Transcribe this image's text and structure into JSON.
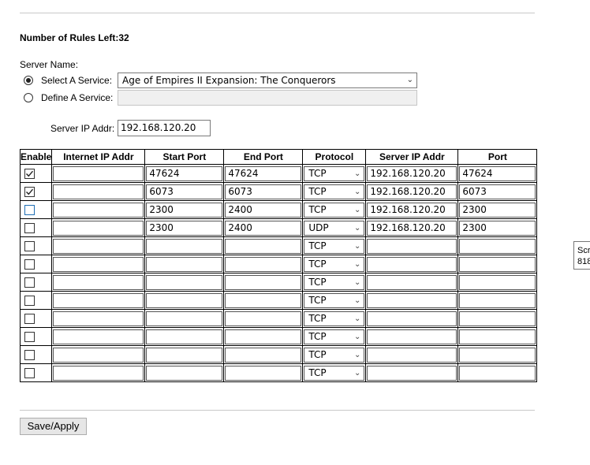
{
  "rules_left_label": "Number of Rules Left:32",
  "server_name_label": "Server Name:",
  "select_service": {
    "label": "Select A Service:",
    "selected": true,
    "value": "Age of Empires II Expansion: The Conquerors"
  },
  "define_service": {
    "label": "Define A Service:",
    "selected": false,
    "value": ""
  },
  "server_ip": {
    "label": "Server IP Addr:",
    "value": "192.168.120.20"
  },
  "table": {
    "headers": [
      "Enable",
      "Internet IP Addr",
      "Start Port",
      "End Port",
      "Protocol",
      "Server IP Addr",
      "Port"
    ],
    "rows": [
      {
        "enabled": true,
        "internet_ip": "",
        "start_port": "47624",
        "end_port": "47624",
        "protocol": "TCP",
        "server_ip": "192.168.120.20",
        "port": "47624"
      },
      {
        "enabled": true,
        "internet_ip": "",
        "start_port": "6073",
        "end_port": "6073",
        "protocol": "TCP",
        "server_ip": "192.168.120.20",
        "port": "6073"
      },
      {
        "enabled": false,
        "internet_ip": "",
        "start_port": "2300",
        "end_port": "2400",
        "protocol": "TCP",
        "server_ip": "192.168.120.20",
        "port": "2300"
      },
      {
        "enabled": false,
        "internet_ip": "",
        "start_port": "2300",
        "end_port": "2400",
        "protocol": "UDP",
        "server_ip": "192.168.120.20",
        "port": "2300"
      },
      {
        "enabled": false,
        "internet_ip": "",
        "start_port": "",
        "end_port": "",
        "protocol": "TCP",
        "server_ip": "",
        "port": ""
      },
      {
        "enabled": false,
        "internet_ip": "",
        "start_port": "",
        "end_port": "",
        "protocol": "TCP",
        "server_ip": "",
        "port": ""
      },
      {
        "enabled": false,
        "internet_ip": "",
        "start_port": "",
        "end_port": "",
        "protocol": "TCP",
        "server_ip": "",
        "port": ""
      },
      {
        "enabled": false,
        "internet_ip": "",
        "start_port": "",
        "end_port": "",
        "protocol": "TCP",
        "server_ip": "",
        "port": ""
      },
      {
        "enabled": false,
        "internet_ip": "",
        "start_port": "",
        "end_port": "",
        "protocol": "TCP",
        "server_ip": "",
        "port": ""
      },
      {
        "enabled": false,
        "internet_ip": "",
        "start_port": "",
        "end_port": "",
        "protocol": "TCP",
        "server_ip": "",
        "port": ""
      },
      {
        "enabled": false,
        "internet_ip": "",
        "start_port": "",
        "end_port": "",
        "protocol": "TCP",
        "server_ip": "",
        "port": ""
      },
      {
        "enabled": false,
        "internet_ip": "",
        "start_port": "",
        "end_port": "",
        "protocol": "TCP",
        "server_ip": "",
        "port": ""
      }
    ]
  },
  "save_button_label": "Save/Apply",
  "tooltip": {
    "line1": "Scr",
    "line2": "818"
  }
}
